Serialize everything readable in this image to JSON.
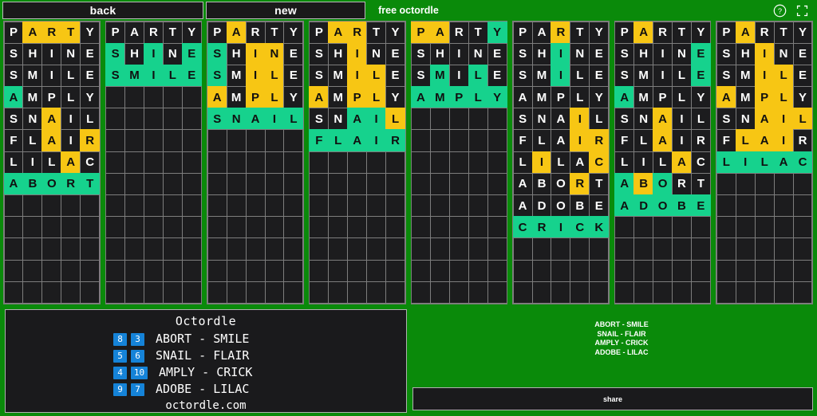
{
  "header": {
    "back_label": "back",
    "new_label": "new",
    "title": "free octordle",
    "help_icon": "question-circle-icon",
    "fullscreen_icon": "fullscreen-icon"
  },
  "board_config": {
    "rows": 13,
    "cols": 5,
    "colors": {
      "green": "#16d28d",
      "yellow": "#f7c614",
      "empty": "#1c1c1e",
      "background": "#0a8a0a",
      "panel": "#1a1a1c",
      "badge": "#1583d8"
    }
  },
  "boards": [
    {
      "index": 1,
      "solved_word": "ABORT",
      "guesses": [
        {
          "word": "PARTY",
          "states": [
            "absent",
            "present",
            "present",
            "present",
            "absent"
          ]
        },
        {
          "word": "SHINE",
          "states": [
            "absent",
            "absent",
            "absent",
            "absent",
            "absent"
          ]
        },
        {
          "word": "SMILE",
          "states": [
            "absent",
            "absent",
            "absent",
            "absent",
            "absent"
          ]
        },
        {
          "word": "AMPLY",
          "states": [
            "correct",
            "absent",
            "absent",
            "absent",
            "absent"
          ]
        },
        {
          "word": "SNAIL",
          "states": [
            "absent",
            "absent",
            "present",
            "absent",
            "absent"
          ]
        },
        {
          "word": "FLAIR",
          "states": [
            "absent",
            "absent",
            "present",
            "absent",
            "present"
          ]
        },
        {
          "word": "LILAC",
          "states": [
            "absent",
            "absent",
            "absent",
            "present",
            "absent"
          ]
        },
        {
          "word": "ABORT",
          "states": [
            "correct",
            "correct",
            "correct",
            "correct",
            "correct"
          ]
        }
      ]
    },
    {
      "index": 2,
      "solved_word": "SMILE",
      "guesses": [
        {
          "word": "PARTY",
          "states": [
            "absent",
            "absent",
            "absent",
            "absent",
            "absent"
          ]
        },
        {
          "word": "SHINE",
          "states": [
            "correct",
            "absent",
            "correct",
            "absent",
            "correct"
          ]
        },
        {
          "word": "SMILE",
          "states": [
            "correct",
            "correct",
            "correct",
            "correct",
            "correct"
          ]
        }
      ]
    },
    {
      "index": 3,
      "solved_word": "SNAIL",
      "guesses": [
        {
          "word": "PARTY",
          "states": [
            "absent",
            "present",
            "absent",
            "absent",
            "absent"
          ]
        },
        {
          "word": "SHINE",
          "states": [
            "correct",
            "absent",
            "present",
            "present",
            "absent"
          ]
        },
        {
          "word": "SMILE",
          "states": [
            "correct",
            "absent",
            "present",
            "present",
            "absent"
          ]
        },
        {
          "word": "AMPLY",
          "states": [
            "present",
            "absent",
            "present",
            "present",
            "absent"
          ]
        },
        {
          "word": "SNAIL",
          "states": [
            "correct",
            "correct",
            "correct",
            "correct",
            "correct"
          ]
        }
      ]
    },
    {
      "index": 4,
      "solved_word": "FLAIR",
      "guesses": [
        {
          "word": "PARTY",
          "states": [
            "absent",
            "present",
            "present",
            "absent",
            "absent"
          ]
        },
        {
          "word": "SHINE",
          "states": [
            "absent",
            "absent",
            "present",
            "absent",
            "absent"
          ]
        },
        {
          "word": "SMILE",
          "states": [
            "absent",
            "absent",
            "present",
            "present",
            "absent"
          ]
        },
        {
          "word": "AMPLY",
          "states": [
            "present",
            "absent",
            "present",
            "present",
            "absent"
          ]
        },
        {
          "word": "SNAIL",
          "states": [
            "absent",
            "absent",
            "correct",
            "correct",
            "present"
          ]
        },
        {
          "word": "FLAIR",
          "states": [
            "correct",
            "correct",
            "correct",
            "correct",
            "correct"
          ]
        }
      ]
    },
    {
      "index": 5,
      "solved_word": "AMPLY",
      "guesses": [
        {
          "word": "PARTY",
          "states": [
            "present",
            "present",
            "absent",
            "absent",
            "correct"
          ]
        },
        {
          "word": "SHINE",
          "states": [
            "absent",
            "absent",
            "absent",
            "absent",
            "absent"
          ]
        },
        {
          "word": "SMILE",
          "states": [
            "absent",
            "correct",
            "absent",
            "correct",
            "absent"
          ]
        },
        {
          "word": "AMPLY",
          "states": [
            "correct",
            "correct",
            "correct",
            "correct",
            "correct"
          ]
        }
      ]
    },
    {
      "index": 6,
      "solved_word": "CRICK",
      "guesses": [
        {
          "word": "PARTY",
          "states": [
            "absent",
            "absent",
            "present",
            "absent",
            "absent"
          ]
        },
        {
          "word": "SHINE",
          "states": [
            "absent",
            "absent",
            "correct",
            "absent",
            "absent"
          ]
        },
        {
          "word": "SMILE",
          "states": [
            "absent",
            "absent",
            "correct",
            "absent",
            "absent"
          ]
        },
        {
          "word": "AMPLY",
          "states": [
            "absent",
            "absent",
            "absent",
            "absent",
            "absent"
          ]
        },
        {
          "word": "SNAIL",
          "states": [
            "absent",
            "absent",
            "absent",
            "present",
            "absent"
          ]
        },
        {
          "word": "FLAIR",
          "states": [
            "absent",
            "absent",
            "absent",
            "present",
            "present"
          ]
        },
        {
          "word": "LILAC",
          "states": [
            "absent",
            "present",
            "absent",
            "absent",
            "present"
          ]
        },
        {
          "word": "ABORT",
          "states": [
            "absent",
            "absent",
            "absent",
            "present",
            "absent"
          ]
        },
        {
          "word": "ADOBE",
          "states": [
            "absent",
            "absent",
            "absent",
            "absent",
            "absent"
          ]
        },
        {
          "word": "CRICK",
          "states": [
            "correct",
            "correct",
            "correct",
            "correct",
            "correct"
          ]
        }
      ]
    },
    {
      "index": 7,
      "solved_word": "ADOBE",
      "guesses": [
        {
          "word": "PARTY",
          "states": [
            "absent",
            "present",
            "absent",
            "absent",
            "absent"
          ]
        },
        {
          "word": "SHINE",
          "states": [
            "absent",
            "absent",
            "absent",
            "absent",
            "correct"
          ]
        },
        {
          "word": "SMILE",
          "states": [
            "absent",
            "absent",
            "absent",
            "absent",
            "correct"
          ]
        },
        {
          "word": "AMPLY",
          "states": [
            "correct",
            "absent",
            "absent",
            "absent",
            "absent"
          ]
        },
        {
          "word": "SNAIL",
          "states": [
            "absent",
            "absent",
            "present",
            "absent",
            "absent"
          ]
        },
        {
          "word": "FLAIR",
          "states": [
            "absent",
            "absent",
            "present",
            "absent",
            "absent"
          ]
        },
        {
          "word": "LILAC",
          "states": [
            "absent",
            "absent",
            "absent",
            "present",
            "absent"
          ]
        },
        {
          "word": "ABORT",
          "states": [
            "correct",
            "present",
            "correct",
            "absent",
            "absent"
          ]
        },
        {
          "word": "ADOBE",
          "states": [
            "correct",
            "correct",
            "correct",
            "correct",
            "correct"
          ]
        }
      ]
    },
    {
      "index": 8,
      "solved_word": "LILAC",
      "guesses": [
        {
          "word": "PARTY",
          "states": [
            "absent",
            "present",
            "absent",
            "absent",
            "absent"
          ]
        },
        {
          "word": "SHINE",
          "states": [
            "absent",
            "absent",
            "present",
            "absent",
            "absent"
          ]
        },
        {
          "word": "SMILE",
          "states": [
            "absent",
            "absent",
            "present",
            "present",
            "absent"
          ]
        },
        {
          "word": "AMPLY",
          "states": [
            "present",
            "absent",
            "present",
            "present",
            "absent"
          ]
        },
        {
          "word": "SNAIL",
          "states": [
            "absent",
            "absent",
            "present",
            "present",
            "present"
          ]
        },
        {
          "word": "FLAIR",
          "states": [
            "absent",
            "present",
            "present",
            "present",
            "absent"
          ]
        },
        {
          "word": "LILAC",
          "states": [
            "correct",
            "correct",
            "correct",
            "correct",
            "correct"
          ]
        }
      ]
    }
  ],
  "results": {
    "title": "Octordle",
    "rows": [
      {
        "left_score": "8",
        "right_score": "3",
        "words": "ABORT - SMILE"
      },
      {
        "left_score": "5",
        "right_score": "6",
        "words": "SNAIL - FLAIR"
      },
      {
        "left_score": "4",
        "right_score": "10",
        "words": "AMPLY - CRICK"
      },
      {
        "left_score": "9",
        "right_score": "7",
        "words": "ADOBE - LILAC"
      }
    ],
    "site": "octordle.com"
  },
  "summary": {
    "lines": [
      "ABORT - SMILE",
      "SNAIL - FLAIR",
      "AMPLY - CRICK",
      "ADOBE - LILAC"
    ],
    "share_label": "share"
  }
}
